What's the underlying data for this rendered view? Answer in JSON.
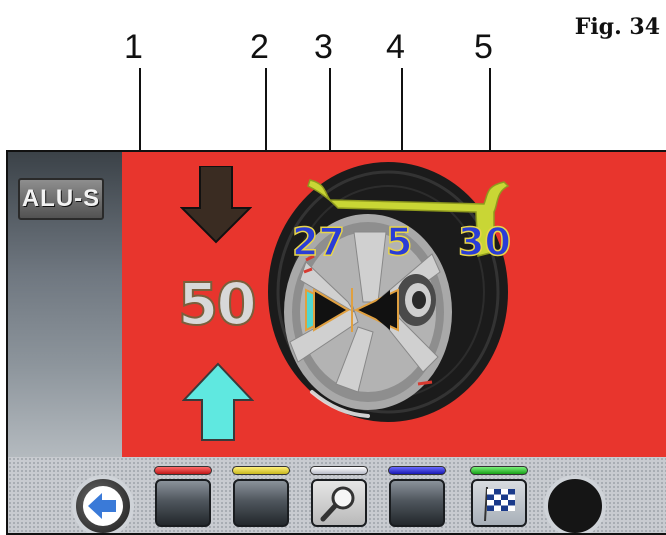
{
  "figure_label": "Fig. 34",
  "callouts": [
    "1",
    "2",
    "3",
    "4",
    "5"
  ],
  "screen": {
    "mode_badge": "ALU-S",
    "weight_value": "50",
    "position_values": {
      "left": "27",
      "center": "5",
      "right": "30"
    },
    "colors": {
      "background": "#e8352d",
      "arrow_up": "#5fe8e0",
      "arrow_down": "#3a2c22",
      "position_numbers": "#2a3dd6",
      "rim_profile": "#c9d635"
    }
  },
  "toolbar": {
    "buttons": [
      {
        "name": "back",
        "icon": "arrow-left-icon"
      },
      {
        "name": "f1",
        "led": "#e03030"
      },
      {
        "name": "f2",
        "led": "#e0d030"
      },
      {
        "name": "f3",
        "led": "#d8d8e0",
        "icon": "magnifier-icon"
      },
      {
        "name": "f4",
        "led": "#2a2ad0"
      },
      {
        "name": "f5",
        "led": "#30c030",
        "icon": "checkered-flag-icon"
      },
      {
        "name": "round-right"
      }
    ]
  }
}
